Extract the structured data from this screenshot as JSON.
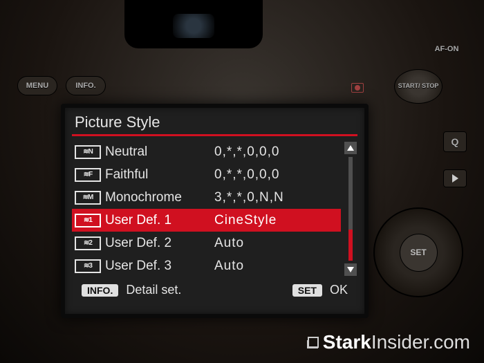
{
  "physical": {
    "menu": "MENU",
    "info": "INFO.",
    "afon": "AF-ON",
    "startstop": "START/\nSTOP",
    "q": "Q",
    "set": "SET"
  },
  "lcd": {
    "title": "Picture Style",
    "rows": [
      {
        "icon": "≋N",
        "name": "Neutral",
        "value": "0,*,*,0,0,0",
        "selected": false
      },
      {
        "icon": "≋F",
        "name": "Faithful",
        "value": "0,*,*,0,0,0",
        "selected": false
      },
      {
        "icon": "≋M",
        "name": "Monochrome",
        "value": "3,*,*,0,N,N",
        "selected": false
      },
      {
        "icon": "≋1",
        "name": "User Def. 1",
        "value": "CineStyle",
        "selected": true
      },
      {
        "icon": "≋2",
        "name": "User Def. 2",
        "value": "Auto",
        "selected": false
      },
      {
        "icon": "≋3",
        "name": "User Def. 3",
        "value": "Auto",
        "selected": false
      }
    ],
    "footer": {
      "left_key": "INFO.",
      "left_label": "Detail set.",
      "right_key": "SET",
      "right_label": "OK"
    }
  },
  "watermark": {
    "brand_bold": "Stark",
    "brand_light": "Insider",
    "suffix": ".com"
  }
}
